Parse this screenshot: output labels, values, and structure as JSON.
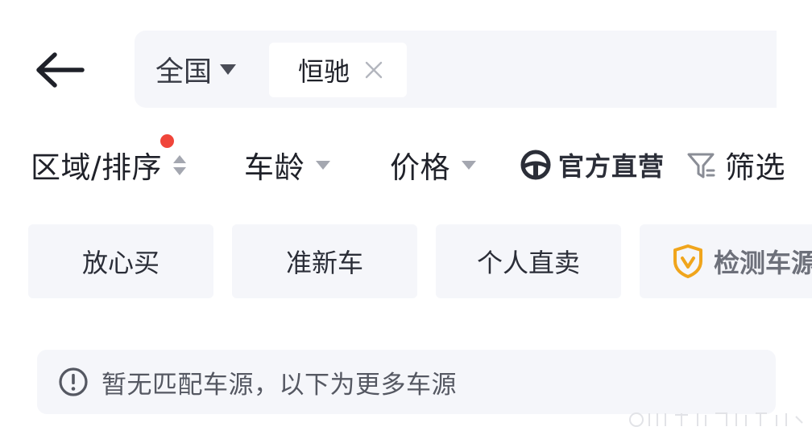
{
  "header": {
    "back_icon": "arrow-left-icon",
    "search": {
      "region": "全国",
      "chip": "恒驰"
    }
  },
  "filters": {
    "area_sort": "区域/排序",
    "car_age": "车龄",
    "price": "价格",
    "official": "官方直营",
    "filter": "筛选"
  },
  "tags": [
    "放心买",
    "准新车",
    "个人直卖",
    "检测车源"
  ],
  "notice": {
    "text": "暂无匹配车源，以下为更多车源"
  },
  "colors": {
    "accent_red_dot": "#f0453a",
    "shield_orange": "#f0a51c",
    "panel_bg": "#f5f6fa"
  }
}
